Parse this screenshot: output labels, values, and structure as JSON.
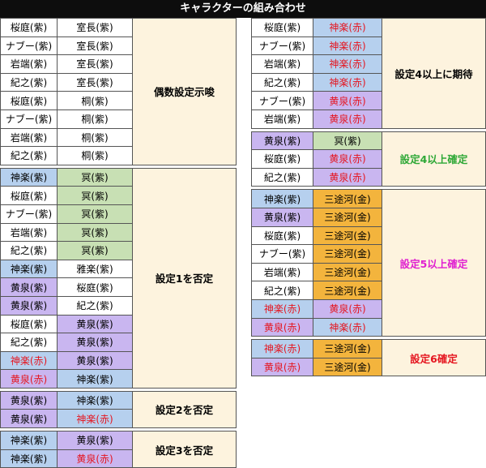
{
  "title": "キャラクターの組み合わせ",
  "colors": {
    "white": "#ffffff",
    "blue": "#b6d0ee",
    "purple": "#c9b6f0",
    "green": "#c8e0b4",
    "gold": "#f3b43d",
    "result_bg": "#fdf3de",
    "red_text": "#e5151f",
    "green_text": "#2ea836",
    "magenta_text": "#e020d0"
  },
  "left_groups": [
    {
      "result": "偶数設定示唆",
      "result_color": "#000000",
      "rows": [
        [
          {
            "t": "桜庭(紫)",
            "bg": "white"
          },
          {
            "t": "室長(紫)",
            "bg": "white"
          }
        ],
        [
          {
            "t": "ナブー(紫)",
            "bg": "white"
          },
          {
            "t": "室長(紫)",
            "bg": "white"
          }
        ],
        [
          {
            "t": "岩端(紫)",
            "bg": "white"
          },
          {
            "t": "室長(紫)",
            "bg": "white"
          }
        ],
        [
          {
            "t": "紀之(紫)",
            "bg": "white"
          },
          {
            "t": "室長(紫)",
            "bg": "white"
          }
        ],
        [
          {
            "t": "桜庭(紫)",
            "bg": "white"
          },
          {
            "t": "桐(紫)",
            "bg": "white"
          }
        ],
        [
          {
            "t": "ナブー(紫)",
            "bg": "white"
          },
          {
            "t": "桐(紫)",
            "bg": "white"
          }
        ],
        [
          {
            "t": "岩端(紫)",
            "bg": "white"
          },
          {
            "t": "桐(紫)",
            "bg": "white"
          }
        ],
        [
          {
            "t": "紀之(紫)",
            "bg": "white"
          },
          {
            "t": "桐(紫)",
            "bg": "white"
          }
        ]
      ]
    },
    {
      "result": "設定1を否定",
      "result_color": "#000000",
      "rows": [
        [
          {
            "t": "神楽(紫)",
            "bg": "blue"
          },
          {
            "t": "冥(紫)",
            "bg": "green"
          }
        ],
        [
          {
            "t": "桜庭(紫)",
            "bg": "white"
          },
          {
            "t": "冥(紫)",
            "bg": "green"
          }
        ],
        [
          {
            "t": "ナブー(紫)",
            "bg": "white"
          },
          {
            "t": "冥(紫)",
            "bg": "green"
          }
        ],
        [
          {
            "t": "岩端(紫)",
            "bg": "white"
          },
          {
            "t": "冥(紫)",
            "bg": "green"
          }
        ],
        [
          {
            "t": "紀之(紫)",
            "bg": "white"
          },
          {
            "t": "冥(紫)",
            "bg": "green"
          }
        ],
        [
          {
            "t": "神楽(紫)",
            "bg": "blue"
          },
          {
            "t": "雅楽(紫)",
            "bg": "white"
          }
        ],
        [
          {
            "t": "黄泉(紫)",
            "bg": "purple"
          },
          {
            "t": "桜庭(紫)",
            "bg": "white"
          }
        ],
        [
          {
            "t": "黄泉(紫)",
            "bg": "purple"
          },
          {
            "t": "紀之(紫)",
            "bg": "white"
          }
        ],
        [
          {
            "t": "桜庭(紫)",
            "bg": "white"
          },
          {
            "t": "黄泉(紫)",
            "bg": "purple"
          }
        ],
        [
          {
            "t": "紀之(紫)",
            "bg": "white"
          },
          {
            "t": "黄泉(紫)",
            "bg": "purple"
          }
        ],
        [
          {
            "t": "神楽(赤)",
            "bg": "blue",
            "red": true
          },
          {
            "t": "黄泉(紫)",
            "bg": "purple"
          }
        ],
        [
          {
            "t": "黄泉(赤)",
            "bg": "purple",
            "red": true
          },
          {
            "t": "神楽(紫)",
            "bg": "blue"
          }
        ]
      ]
    },
    {
      "result": "設定2を否定",
      "result_color": "#000000",
      "rows": [
        [
          {
            "t": "黄泉(紫)",
            "bg": "purple"
          },
          {
            "t": "神楽(紫)",
            "bg": "blue"
          }
        ],
        [
          {
            "t": "黄泉(紫)",
            "bg": "purple"
          },
          {
            "t": "神楽(赤)",
            "bg": "blue",
            "red": true
          }
        ]
      ]
    },
    {
      "result": "設定3を否定",
      "result_color": "#000000",
      "rows": [
        [
          {
            "t": "神楽(紫)",
            "bg": "blue"
          },
          {
            "t": "黄泉(紫)",
            "bg": "purple"
          }
        ],
        [
          {
            "t": "神楽(紫)",
            "bg": "blue"
          },
          {
            "t": "黄泉(赤)",
            "bg": "purple",
            "red": true
          }
        ]
      ]
    }
  ],
  "right_groups": [
    {
      "result": "設定4以上に期待",
      "result_color": "#000000",
      "rows": [
        [
          {
            "t": "桜庭(紫)",
            "bg": "white"
          },
          {
            "t": "神楽(赤)",
            "bg": "blue",
            "red": true
          }
        ],
        [
          {
            "t": "ナブー(紫)",
            "bg": "white"
          },
          {
            "t": "神楽(赤)",
            "bg": "blue",
            "red": true
          }
        ],
        [
          {
            "t": "岩端(紫)",
            "bg": "white"
          },
          {
            "t": "神楽(赤)",
            "bg": "blue",
            "red": true
          }
        ],
        [
          {
            "t": "紀之(紫)",
            "bg": "white"
          },
          {
            "t": "神楽(赤)",
            "bg": "blue",
            "red": true
          }
        ],
        [
          {
            "t": "ナブー(紫)",
            "bg": "white"
          },
          {
            "t": "黄泉(赤)",
            "bg": "purple",
            "red": true
          }
        ],
        [
          {
            "t": "岩端(紫)",
            "bg": "white"
          },
          {
            "t": "黄泉(赤)",
            "bg": "purple",
            "red": true
          }
        ]
      ]
    },
    {
      "result": "設定4以上確定",
      "result_color": "#2ea836",
      "rows": [
        [
          {
            "t": "黄泉(紫)",
            "bg": "purple"
          },
          {
            "t": "冥(紫)",
            "bg": "green"
          }
        ],
        [
          {
            "t": "桜庭(紫)",
            "bg": "white"
          },
          {
            "t": "黄泉(赤)",
            "bg": "purple",
            "red": true
          }
        ],
        [
          {
            "t": "紀之(紫)",
            "bg": "white"
          },
          {
            "t": "黄泉(赤)",
            "bg": "purple",
            "red": true
          }
        ]
      ]
    },
    {
      "result": "設定5以上確定",
      "result_color": "#e020d0",
      "rows": [
        [
          {
            "t": "神楽(紫)",
            "bg": "blue"
          },
          {
            "t": "三途河(金)",
            "bg": "gold"
          }
        ],
        [
          {
            "t": "黄泉(紫)",
            "bg": "purple"
          },
          {
            "t": "三途河(金)",
            "bg": "gold"
          }
        ],
        [
          {
            "t": "桜庭(紫)",
            "bg": "white"
          },
          {
            "t": "三途河(金)",
            "bg": "gold"
          }
        ],
        [
          {
            "t": "ナブー(紫)",
            "bg": "white"
          },
          {
            "t": "三途河(金)",
            "bg": "gold"
          }
        ],
        [
          {
            "t": "岩端(紫)",
            "bg": "white"
          },
          {
            "t": "三途河(金)",
            "bg": "gold"
          }
        ],
        [
          {
            "t": "紀之(紫)",
            "bg": "white"
          },
          {
            "t": "三途河(金)",
            "bg": "gold"
          }
        ],
        [
          {
            "t": "神楽(赤)",
            "bg": "blue",
            "red": true
          },
          {
            "t": "黄泉(赤)",
            "bg": "purple",
            "red": true
          }
        ],
        [
          {
            "t": "黄泉(赤)",
            "bg": "purple",
            "red": true
          },
          {
            "t": "神楽(赤)",
            "bg": "blue",
            "red": true
          }
        ]
      ]
    },
    {
      "result": "設定6確定",
      "result_color": "#e5151f",
      "rows": [
        [
          {
            "t": "神楽(赤)",
            "bg": "blue",
            "red": true
          },
          {
            "t": "三途河(金)",
            "bg": "gold"
          }
        ],
        [
          {
            "t": "黄泉(赤)",
            "bg": "purple",
            "red": true
          },
          {
            "t": "三途河(金)",
            "bg": "gold"
          }
        ]
      ]
    }
  ]
}
